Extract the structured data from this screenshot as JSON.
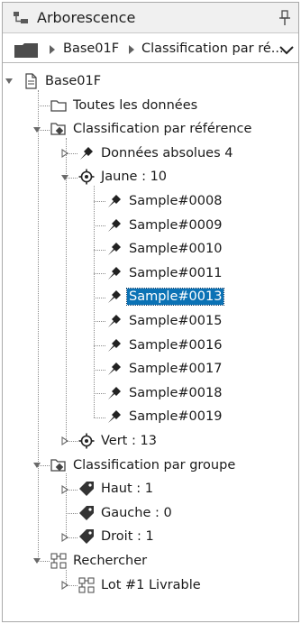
{
  "panel": {
    "title": "Arborescence",
    "title_icon": "tree-view-icon",
    "pin_icon": "pin-icon"
  },
  "breadcrumb": {
    "folder_icon": "folder-icon",
    "segments": [
      "Base01F",
      "Classification par ré..."
    ],
    "dropdown_icon": "chevron-down-icon"
  },
  "tree": {
    "items": [
      {
        "label": "Base01F",
        "icon": "document-icon",
        "expanded": true
      },
      {
        "label": "Toutes les données",
        "icon": "folder-outline-icon"
      },
      {
        "label": "Classification par référence",
        "icon": "classification-icon",
        "expanded": true
      },
      {
        "label": "Données absolues 4",
        "icon": "sample-tool-icon",
        "expanded": false
      },
      {
        "label": "Jaune : 10",
        "icon": "target-icon",
        "expanded": true
      },
      {
        "label": "Sample#0008",
        "icon": "sample-tool-icon"
      },
      {
        "label": "Sample#0009",
        "icon": "sample-tool-icon"
      },
      {
        "label": "Sample#0010",
        "icon": "sample-tool-icon"
      },
      {
        "label": "Sample#0011",
        "icon": "sample-tool-icon"
      },
      {
        "label": "Sample#0013",
        "icon": "sample-tool-icon",
        "selected": true
      },
      {
        "label": "Sample#0015",
        "icon": "sample-tool-icon"
      },
      {
        "label": "Sample#0016",
        "icon": "sample-tool-icon"
      },
      {
        "label": "Sample#0017",
        "icon": "sample-tool-icon"
      },
      {
        "label": "Sample#0018",
        "icon": "sample-tool-icon"
      },
      {
        "label": "Sample#0019",
        "icon": "sample-tool-icon"
      },
      {
        "label": "Vert : 13",
        "icon": "target-icon",
        "expanded": false
      },
      {
        "label": "Classification par groupe",
        "icon": "classification-icon",
        "expanded": true
      },
      {
        "label": "Haut : 1",
        "icon": "tag-icon",
        "expanded": false
      },
      {
        "label": "Gauche : 0",
        "icon": "tag-icon"
      },
      {
        "label": "Droit : 1",
        "icon": "tag-icon",
        "expanded": false
      },
      {
        "label": "Rechercher",
        "icon": "search-structure-icon",
        "expanded": true
      },
      {
        "label": "Lot #1 Livrable",
        "icon": "search-structure-icon",
        "expanded": false
      }
    ]
  },
  "colors": {
    "selection": "#0b72b5",
    "titlebar": "#f0f0f0",
    "border": "#a9a9a9"
  }
}
